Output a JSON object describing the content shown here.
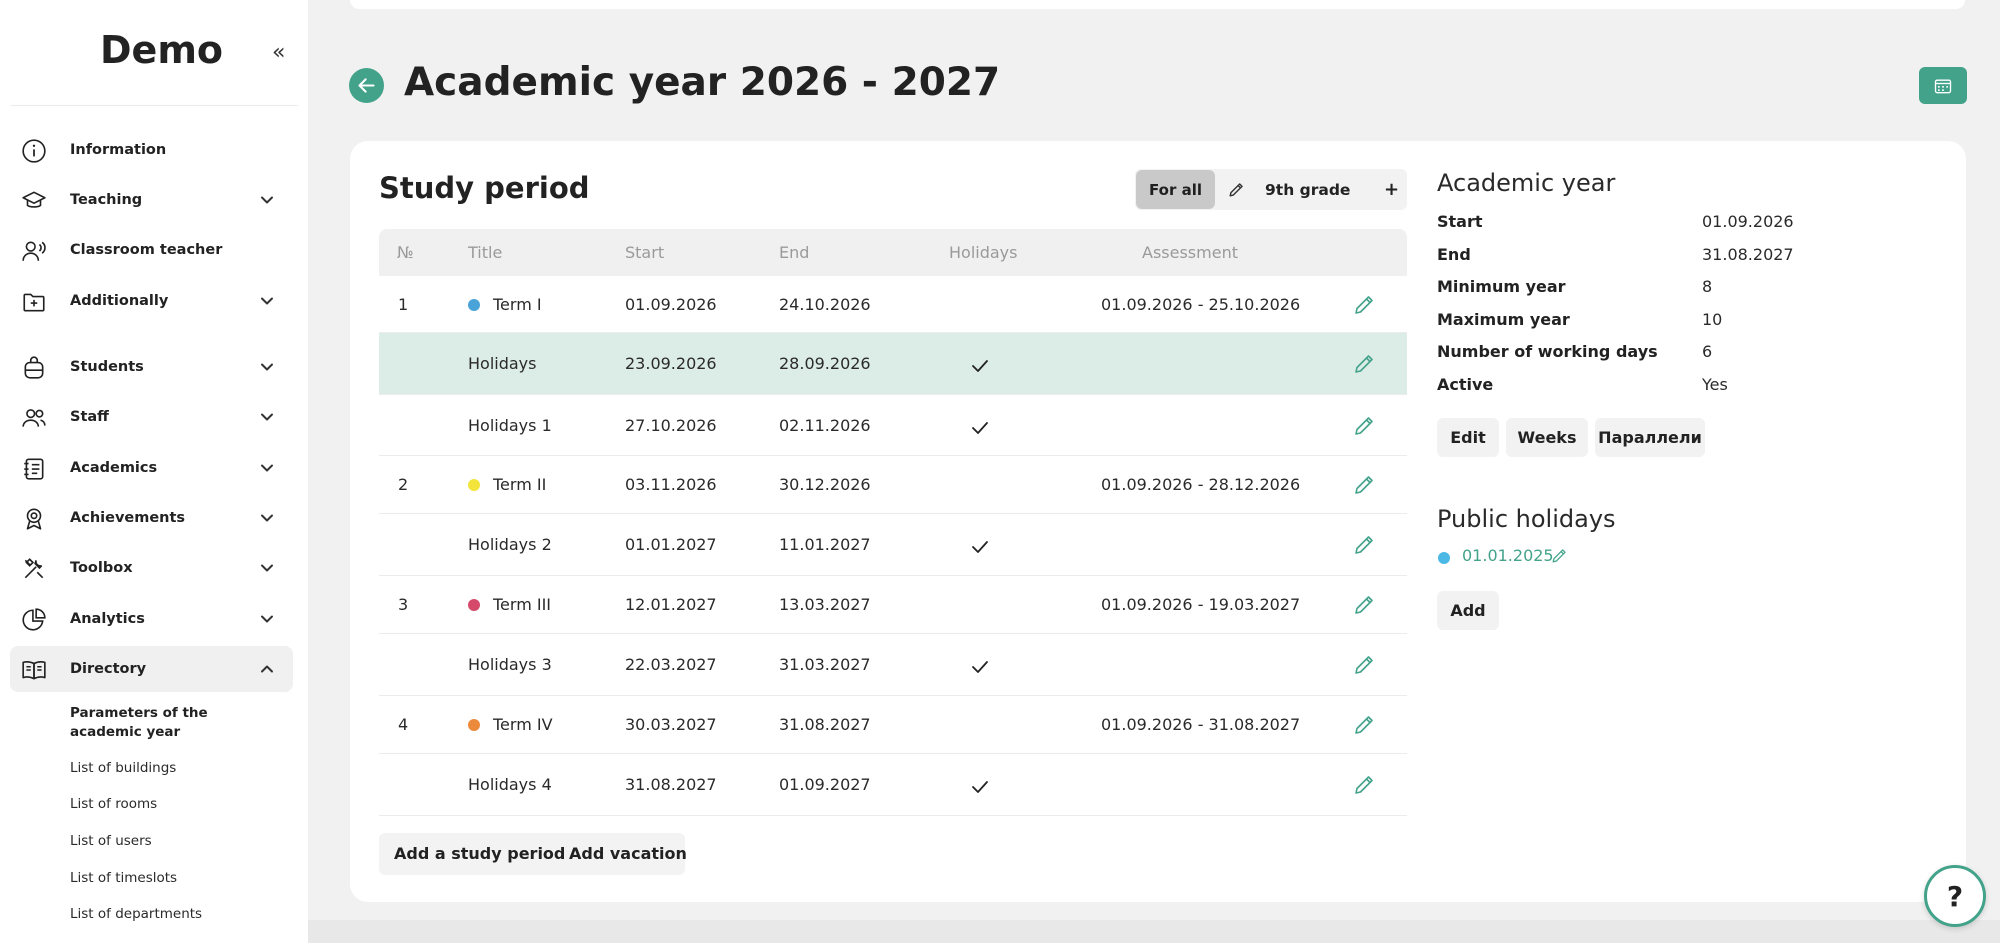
{
  "app": {
    "logo": "Demo",
    "collapse_glyph": "«"
  },
  "sidebar": {
    "items": [
      {
        "label": "Information",
        "icon": "info-icon",
        "has_chevron": false
      },
      {
        "label": "Teaching",
        "icon": "graduation-cap-icon",
        "has_chevron": true
      },
      {
        "label": "Classroom teacher",
        "icon": "teacher-icon",
        "has_chevron": false
      },
      {
        "label": "Additionally",
        "icon": "folder-plus-icon",
        "has_chevron": true
      },
      {
        "label": "Students",
        "icon": "backpack-icon",
        "has_chevron": true
      },
      {
        "label": "Staff",
        "icon": "users-icon",
        "has_chevron": true
      },
      {
        "label": "Academics",
        "icon": "notebook-icon",
        "has_chevron": true
      },
      {
        "label": "Achievements",
        "icon": "award-icon",
        "has_chevron": true
      },
      {
        "label": "Toolbox",
        "icon": "tools-icon",
        "has_chevron": true
      },
      {
        "label": "Analytics",
        "icon": "pie-chart-icon",
        "has_chevron": true
      },
      {
        "label": "Directory",
        "icon": "book-open-icon",
        "has_chevron": true,
        "expanded": true
      }
    ],
    "sub_items": [
      "Parameters of the academic year",
      "List of buildings",
      "List of rooms",
      "List of users",
      "List of timeslots",
      "List of departments"
    ]
  },
  "header": {
    "title": "Academic year 2026 - 2027"
  },
  "study_period": {
    "title": "Study period",
    "filter": {
      "for_all": "For all",
      "grade": "9th grade",
      "add": "+"
    },
    "columns": [
      "№",
      "Title",
      "Start",
      "End",
      "Holidays",
      "Assessment"
    ],
    "rows": [
      {
        "num": "1",
        "title": "Term I",
        "start": "01.09.2026",
        "end": "24.10.2026",
        "holiday": false,
        "assessment": "01.09.2026 - 25.10.2026",
        "dot": "#4aa3d8"
      },
      {
        "num": "",
        "title": "Holidays",
        "start": "23.09.2026",
        "end": "28.09.2026",
        "holiday": true,
        "assessment": "",
        "dot": "",
        "highlight": true
      },
      {
        "num": "",
        "title": "Holidays 1",
        "start": "27.10.2026",
        "end": "02.11.2026",
        "holiday": true,
        "assessment": "",
        "dot": ""
      },
      {
        "num": "2",
        "title": "Term II",
        "start": "03.11.2026",
        "end": "30.12.2026",
        "holiday": false,
        "assessment": "01.09.2026 - 28.12.2026",
        "dot": "#f2e43a"
      },
      {
        "num": "",
        "title": "Holidays 2",
        "start": "01.01.2027",
        "end": "11.01.2027",
        "holiday": true,
        "assessment": "",
        "dot": ""
      },
      {
        "num": "3",
        "title": "Term III",
        "start": "12.01.2027",
        "end": "13.03.2027",
        "holiday": false,
        "assessment": "01.09.2026 - 19.03.2027",
        "dot": "#d54a6b"
      },
      {
        "num": "",
        "title": "Holidays 3",
        "start": "22.03.2027",
        "end": "31.03.2027",
        "holiday": true,
        "assessment": "",
        "dot": ""
      },
      {
        "num": "4",
        "title": "Term IV",
        "start": "30.03.2027",
        "end": "31.08.2027",
        "holiday": false,
        "assessment": "01.09.2026 - 31.08.2027",
        "dot": "#ec8a3c"
      },
      {
        "num": "",
        "title": "Holidays 4",
        "start": "31.08.2027",
        "end": "01.09.2027",
        "holiday": true,
        "assessment": "",
        "dot": ""
      }
    ],
    "actions": {
      "add_study_period": "Add a study period",
      "add_vacation": "Add vacation"
    }
  },
  "academic_year": {
    "title": "Academic year",
    "fields": [
      {
        "key": "Start",
        "value": "01.09.2026"
      },
      {
        "key": "End",
        "value": "31.08.2027"
      },
      {
        "key": "Minimum year",
        "value": "8"
      },
      {
        "key": "Maximum year",
        "value": "10"
      },
      {
        "key": "Number of working days",
        "value": "6"
      },
      {
        "key": "Active",
        "value": "Yes"
      }
    ],
    "buttons": {
      "edit": "Edit",
      "weeks": "Weeks",
      "parallels": "Параллели"
    }
  },
  "public_holidays": {
    "title": "Public holidays",
    "items": [
      {
        "date": "01.01.2025",
        "dot": "#4cb8e6"
      }
    ],
    "add": "Add"
  },
  "help": {
    "label": "?"
  },
  "colors": {
    "accent": "#43a38a",
    "highlight_row": "#dcece7"
  }
}
